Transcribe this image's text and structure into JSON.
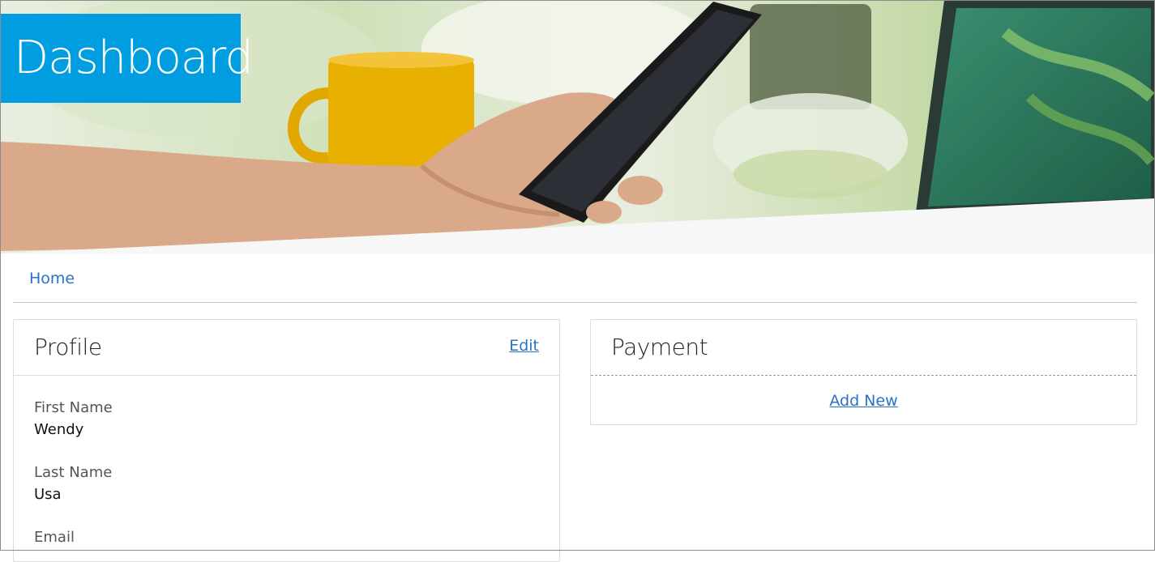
{
  "header": {
    "title": "Dashboard"
  },
  "breadcrumb": {
    "home": "Home"
  },
  "profile": {
    "title": "Profile",
    "edit_label": "Edit",
    "fields": [
      {
        "label": "First Name",
        "value": "Wendy"
      },
      {
        "label": "Last Name",
        "value": "Usa"
      },
      {
        "label": "Email",
        "value": ""
      }
    ]
  },
  "payment": {
    "title": "Payment",
    "add_new_label": "Add New"
  },
  "colors": {
    "accent": "#009ee0",
    "link": "#2a72c8"
  }
}
